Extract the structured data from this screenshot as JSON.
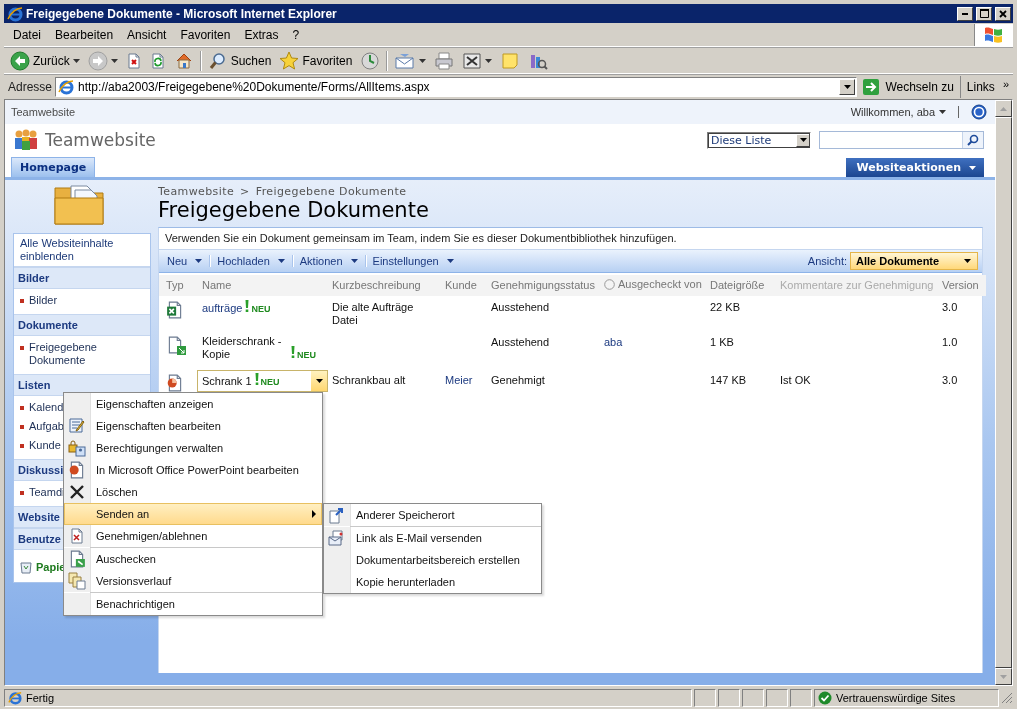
{
  "window": {
    "title": "Freigegebene Dokumente - Microsoft Internet Explorer"
  },
  "menu_bar": [
    "Datei",
    "Bearbeiten",
    "Ansicht",
    "Favoriten",
    "Extras",
    "?"
  ],
  "toolbar": [
    [
      {
        "kind": "back",
        "label": "Zurück",
        "dropdown": true
      },
      {
        "kind": "forward",
        "dropdown": true
      },
      {
        "kind": "stop",
        "dropdown": false
      },
      {
        "kind": "refresh",
        "dropdown": false
      },
      {
        "kind": "home",
        "dropdown": false
      }
    ],
    [
      {
        "kind": "search",
        "label": "Suchen",
        "dropdown": false
      },
      {
        "kind": "favorites",
        "label": "Favoriten",
        "dropdown": false
      },
      {
        "kind": "history",
        "dropdown": false
      }
    ],
    [
      {
        "kind": "mail",
        "dropdown": true
      },
      {
        "kind": "print",
        "dropdown": false
      },
      {
        "kind": "edit",
        "dropdown": true
      },
      {
        "kind": "notes",
        "dropdown": false
      },
      {
        "kind": "research",
        "dropdown": false
      }
    ]
  ],
  "address_bar": {
    "label": "Adresse",
    "url": "http://aba2003/Freigegebene%20Dokumente/Forms/AllItems.aspx",
    "go": "Wechseln zu",
    "links": "Links",
    "more": "»"
  },
  "site": {
    "top_bar": {
      "site": "Teamwebsite",
      "welcome": "Willkommen, aba"
    },
    "title": "Teamwebsite",
    "search_scope": "Diese Liste",
    "tabs": [
      {
        "label": "Homepage",
        "selected": true
      }
    ],
    "site_actions": "Websiteaktionen"
  },
  "sidebar": {
    "all_content": "Alle Websiteinhalte einblenden",
    "sections": [
      {
        "heading": "Bilder",
        "items": [
          "Bilder"
        ]
      },
      {
        "heading": "Dokumente",
        "items": [
          "Freigegebene Dokumente"
        ]
      },
      {
        "heading": "Listen",
        "items": [
          "Kalend",
          "Aufgab",
          "Kunde"
        ]
      },
      {
        "heading": "Diskussi",
        "items": [
          "Teamdi"
        ]
      },
      {
        "heading": "Website"
      },
      {
        "heading": "Benutze"
      }
    ],
    "recycle_bin": "Papie"
  },
  "library": {
    "breadcrumb": {
      "items": [
        "Teamwebsite",
        "Freigegebene Dokumente"
      ],
      "separator": ">"
    },
    "title": "Freigegebene Dokumente",
    "description": "Verwenden Sie ein Dokument gemeinsam im Team, indem Sie es dieser Dokumentbibliothek hinzufügen.",
    "toolbar": [
      "Neu",
      "Hochladen",
      "Aktionen",
      "Einstellungen"
    ],
    "view_label": "Ansicht:",
    "view": "Alle Dokumente",
    "columns": [
      {
        "label": "Typ",
        "kind": "plain",
        "sortable": true
      },
      {
        "label": "Name",
        "kind": "plain",
        "sortable": true
      },
      {
        "label": "Kurzbeschreibung",
        "kind": "plain",
        "sortable": true
      },
      {
        "label": "Kunde",
        "kind": "plain",
        "sortable": true
      },
      {
        "label": "Genehmigungsstatus",
        "kind": "plain",
        "sortable": true
      },
      {
        "label": "Ausgecheckt von",
        "kind": "checkout",
        "sortable": true
      },
      {
        "label": "Dateigröße",
        "kind": "plain",
        "sortable": true
      },
      {
        "label": "Kommentare zur Genehmigung",
        "kind": "plain",
        "sortable": false
      },
      {
        "label": "Version",
        "kind": "plain",
        "sortable": true
      }
    ],
    "rows": [
      {
        "kind": "excel",
        "name": "aufträge",
        "badge": "NEU",
        "description": "Die alte Aufträge Datei",
        "status": "Ausstehend",
        "size": "22 KB",
        "version": "3.0",
        "checked_out": false,
        "selected": false
      },
      {
        "kind": "document",
        "name": "Kleiderschrank - Kopie",
        "badge": "NEU",
        "status": "Ausstehend",
        "checked_out_by": "aba",
        "size": "1 KB",
        "version": "1.0",
        "checked_out": true,
        "selected": false
      },
      {
        "kind": "powerpoint",
        "name": "Schrank 1",
        "badge": "NEU",
        "description": "Schrankbau alt",
        "customer": "Meier",
        "status": "Genehmigt",
        "size": "147 KB",
        "comment": "Ist OK",
        "version": "3.0",
        "checked_out": false,
        "selected": true
      }
    ]
  },
  "context_menu": {
    "groups": [
      [
        {
          "label": "Eigenschaften anzeigen",
          "kind": "plain",
          "submenu": false,
          "selected": false
        },
        {
          "label": "Eigenschaften bearbeiten",
          "kind": "edit-form",
          "submenu": false,
          "selected": false
        },
        {
          "label": "Berechtigungen verwalten",
          "kind": "permissions",
          "submenu": false,
          "selected": false
        },
        {
          "label": "In Microsoft Office PowerPoint bearbeiten",
          "kind": "powerpoint",
          "submenu": false,
          "selected": false
        },
        {
          "label": "Löschen",
          "kind": "delete",
          "submenu": false,
          "selected": false
        },
        {
          "label": "Senden an",
          "kind": "plain",
          "submenu": true,
          "selected": true
        },
        {
          "label": "Genehmigen/ablehnen",
          "kind": "approve",
          "submenu": false,
          "selected": false
        }
      ],
      [
        {
          "label": "Auschecken",
          "kind": "checkout",
          "submenu": false,
          "selected": false
        },
        {
          "label": "Versionsverlauf",
          "kind": "versions",
          "submenu": false,
          "selected": false
        }
      ],
      [
        {
          "label": "Benachrichtigen",
          "kind": "plain",
          "submenu": false,
          "selected": false
        }
      ]
    ],
    "submenu": {
      "groups": [
        [
          {
            "label": "Anderer Speicherort",
            "kind": "move",
            "selected": false
          }
        ],
        [
          {
            "label": "Link als E-Mail versenden",
            "kind": "mail",
            "selected": false
          },
          {
            "label": "Dokumentarbeitsbereich erstellen",
            "kind": "plain",
            "selected": false
          },
          {
            "label": "Kopie herunterladen",
            "kind": "plain",
            "selected": false
          }
        ]
      ]
    }
  },
  "status_bar": {
    "text": "Fertig",
    "zone": "Vertrauenswürdige Sites"
  }
}
